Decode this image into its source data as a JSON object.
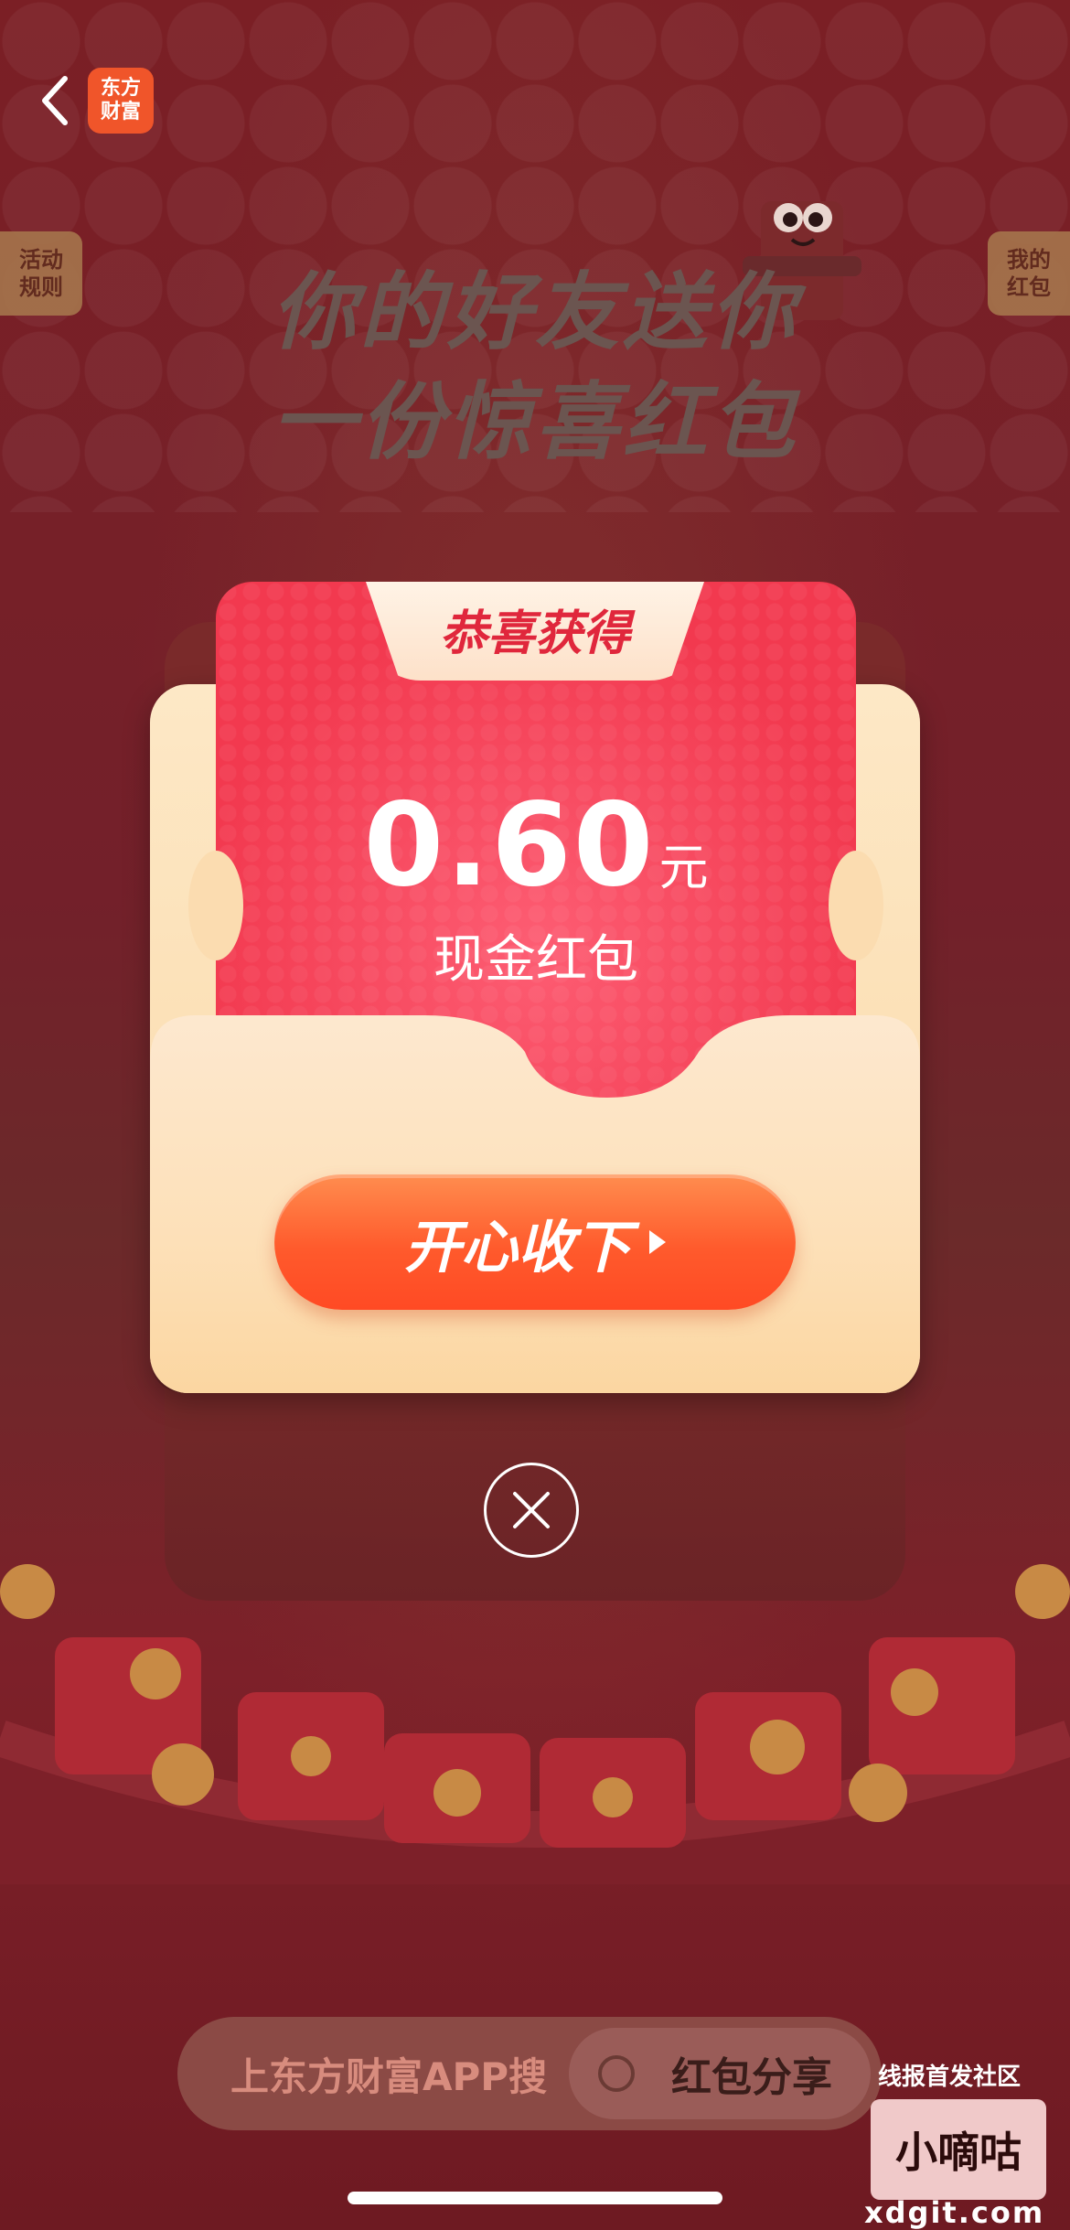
{
  "nav": {
    "logo_line1": "东方",
    "logo_line2": "财富"
  },
  "side_tabs": {
    "left_line1": "活动",
    "left_line2": "规则",
    "right_line1": "我的",
    "right_line2": "红包"
  },
  "headline": {
    "line1": "你的好友送你",
    "line2": "一份惊喜红包"
  },
  "popup": {
    "title": "恭喜获得",
    "amount": "0.60",
    "unit": "元",
    "label": "现金红包",
    "cta": "开心收下"
  },
  "search": {
    "prefix": "上东方财富APP搜",
    "keyword": "红包分享"
  },
  "watermark": {
    "top_text": "线报首发社区",
    "box_text": "小嘀咕",
    "domain": "xdgit.com"
  },
  "colors": {
    "red_card": "#f2394f",
    "cta": "#ff5a2c",
    "envelope": "#fde0b8",
    "background": "#7a1f25",
    "logo": "#f0552a"
  }
}
